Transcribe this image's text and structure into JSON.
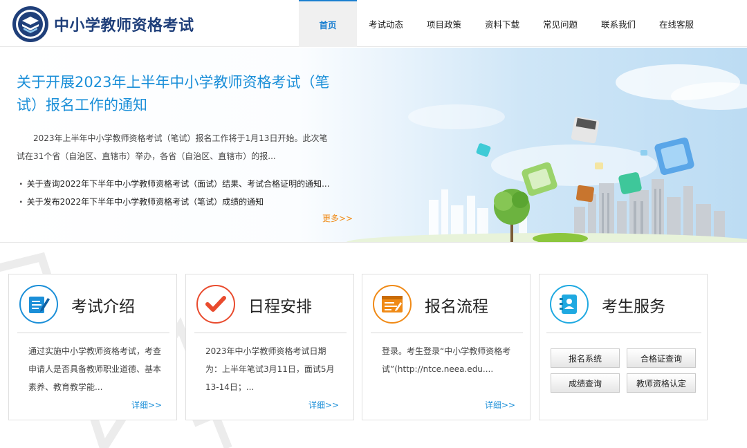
{
  "header": {
    "site_title": "中小学教师资格考试",
    "logo_icon": "book-emblem-icon",
    "brand_color": "#1f3f7a"
  },
  "nav": {
    "items": [
      {
        "label": "首页",
        "active": true
      },
      {
        "label": "考试动态"
      },
      {
        "label": "项目政策"
      },
      {
        "label": "资料下载"
      },
      {
        "label": "常见问题"
      },
      {
        "label": "联系我们"
      },
      {
        "label": "在线客服"
      }
    ],
    "accent_color": "#1a7fd0"
  },
  "banner": {
    "headline": "关于开展2023年上半年中小学教师资格考试（笔试）报名工作的通知",
    "summary": "2023年上半年中小学教师资格考试（笔试）报名工作将于1月13日开始。此次笔试在31个省（自治区、直辖市）举办，各省（自治区、直辖市）的报...",
    "news": [
      "关于查询2022年下半年中小学教师资格考试（面试）结果、考试合格证明的通知...",
      "关于发布2022年下半年中小学教师资格考试（笔试）成绩的通知"
    ],
    "more_label": "更多>>",
    "more_color": "#f08a16"
  },
  "cards": [
    {
      "title": "考试介绍",
      "icon": "edit-document-icon",
      "icon_color": "#1b8fd8",
      "text": "通过实施中小学教师资格考试，考查申请人是否具备教师职业道德、基本素养、教育教学能...",
      "more": "详细>>"
    },
    {
      "title": "日程安排",
      "icon": "checkmark-icon",
      "icon_color": "#e94b2e",
      "text": "2023年中小学教师资格考试日期为：上半年笔试3月11日，面试5月13-14日；...",
      "more": "详细>>"
    },
    {
      "title": "报名流程",
      "icon": "form-window-icon",
      "icon_color": "#f08a16",
      "text": "登录。考生登录“中小学教师资格考试”(http://ntce.neea.edu....",
      "more": "详细>>"
    },
    {
      "title": "考生服务",
      "icon": "contact-book-icon",
      "icon_color": "#1fa9e1",
      "buttons": [
        "报名系统",
        "合格证查询",
        "成绩查询",
        "教师资格认定"
      ]
    }
  ]
}
